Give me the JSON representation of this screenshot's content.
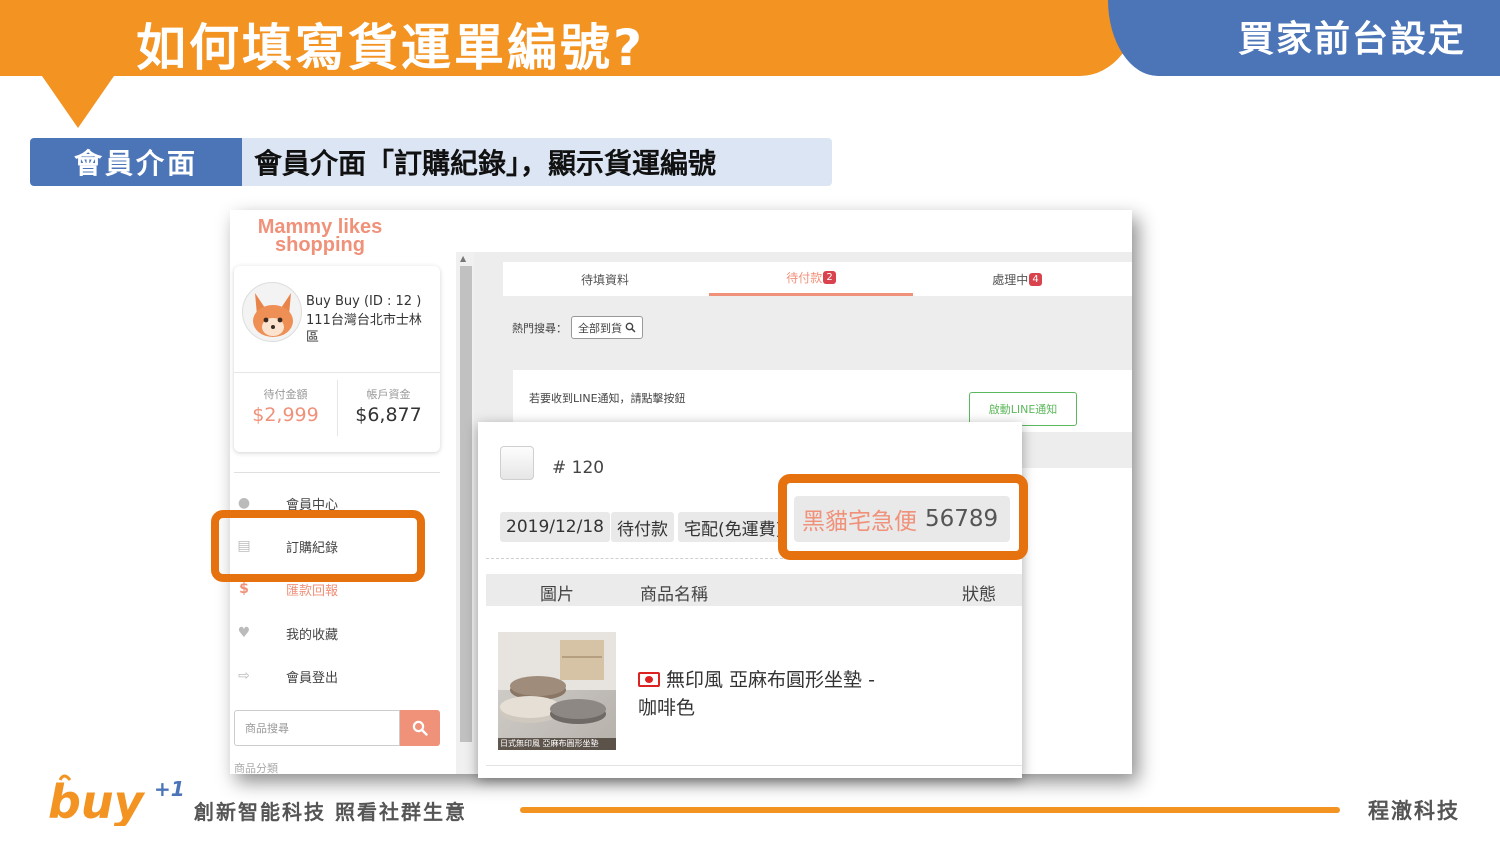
{
  "slide": {
    "title": "如何填寫貨運單編號?",
    "corner_title": "買家前台設定",
    "tag": "會員介面",
    "subtitle": "會員介面「訂購紀錄」，顯示貨運編號"
  },
  "shop": {
    "logo_line1": "Mammy likes",
    "logo_line2": "shopping"
  },
  "profile": {
    "name": "Buy Buy (ID : 12 )",
    "address": "111台灣台北市士林區",
    "pending_label": "待付金額",
    "pending_value": "$2,999",
    "balance_label": "帳戶資金",
    "balance_value": "$6,877"
  },
  "sidebar": {
    "items": [
      {
        "label": "會員中心",
        "icon": "user-icon"
      },
      {
        "label": "訂購紀錄",
        "icon": "card-icon"
      },
      {
        "label": "匯款回報",
        "icon": "dollar-icon"
      },
      {
        "label": "我的收藏",
        "icon": "heart-icon"
      },
      {
        "label": "會員登出",
        "icon": "logout-icon"
      }
    ],
    "search_placeholder": "商品搜尋",
    "category_label": "商品分類"
  },
  "tabs": [
    {
      "label": "待填資料",
      "badge": ""
    },
    {
      "label": "待付款",
      "badge": "2"
    },
    {
      "label": "處理中",
      "badge": "4"
    }
  ],
  "filters": {
    "hot_label": "熱門搜尋：",
    "hot_button": "全部到貨"
  },
  "line_notice": {
    "text": "若要收到LINE通知，請點擊按鈕",
    "button": "啟動LINE通知"
  },
  "order": {
    "number": "# 120",
    "date": "2019/12/18",
    "status": "待付款",
    "shipping": "宅配(免運費)",
    "carrier": "黑貓宅急便",
    "tracking_no": "56789",
    "columns": [
      "圖片",
      "商品名稱",
      "狀態"
    ],
    "product_line1": "無印風 亞麻布圓形坐墊 -",
    "product_line2": "咖啡色",
    "image_caption": "日式無印風 亞麻布圓形坐墊"
  },
  "footer": {
    "slogan": "創新智能科技 照看社群生意",
    "company": "程澈科技",
    "logo_text": "buy",
    "logo_super": "+1"
  },
  "colors": {
    "orange": "#f29322",
    "highlight": "#e6720f",
    "blue": "#4c75b8",
    "salmon": "#f0917a"
  }
}
